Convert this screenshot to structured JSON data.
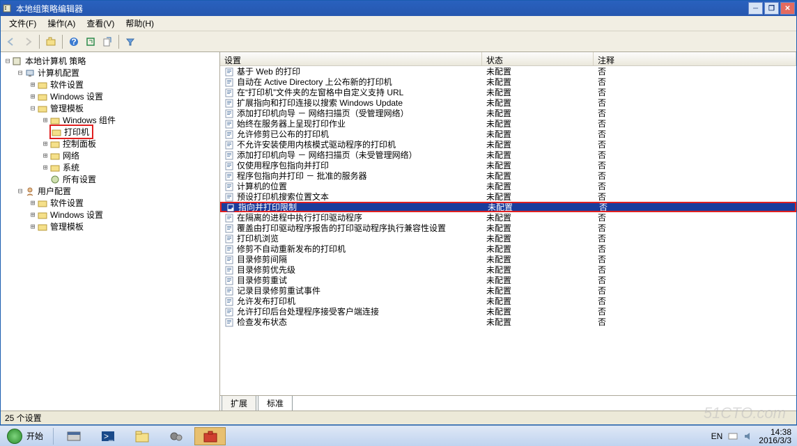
{
  "window": {
    "title": "本地组策略编辑器"
  },
  "menu": {
    "file": "文件(F)",
    "action": "操作(A)",
    "view": "查看(V)",
    "help": "帮助(H)"
  },
  "tree": {
    "root": "本地计算机 策略",
    "computer": "计算机配置",
    "computer_children": {
      "software": "软件设置",
      "windows": "Windows 设置",
      "admin": "管理模板",
      "admin_children": {
        "win_components": "Windows 组件",
        "printers": "打印机",
        "control_panel": "控制面板",
        "network": "网络",
        "system": "系统",
        "all_settings": "所有设置"
      }
    },
    "user": "用户配置",
    "user_children": {
      "software": "软件设置",
      "windows": "Windows 设置",
      "admin": "管理模板"
    }
  },
  "columns": {
    "setting": "设置",
    "state": "状态",
    "comment": "注释"
  },
  "rows": [
    {
      "name": "基于 Web 的打印",
      "state": "未配置",
      "comment": "否"
    },
    {
      "name": "自动在 Active Directory 上公布新的打印机",
      "state": "未配置",
      "comment": "否"
    },
    {
      "name": "在“打印机”文件夹的左窗格中自定义支持 URL",
      "state": "未配置",
      "comment": "否"
    },
    {
      "name": "扩展指向和打印连接以搜索 Windows Update",
      "state": "未配置",
      "comment": "否"
    },
    {
      "name": "添加打印机向导 － 网络扫描页（受管理网络）",
      "state": "未配置",
      "comment": "否"
    },
    {
      "name": "始终在服务器上呈现打印作业",
      "state": "未配置",
      "comment": "否"
    },
    {
      "name": "允许修剪已公布的打印机",
      "state": "未配置",
      "comment": "否"
    },
    {
      "name": "不允许安装使用内核模式驱动程序的打印机",
      "state": "未配置",
      "comment": "否"
    },
    {
      "name": "添加打印机向导 － 网络扫描页（未受管理网络）",
      "state": "未配置",
      "comment": "否"
    },
    {
      "name": "仅使用程序包指向并打印",
      "state": "未配置",
      "comment": "否"
    },
    {
      "name": "程序包指向并打印 － 批准的服务器",
      "state": "未配置",
      "comment": "否"
    },
    {
      "name": "计算机的位置",
      "state": "未配置",
      "comment": "否"
    },
    {
      "name": "预设打印机搜索位置文本",
      "state": "未配置",
      "comment": "否"
    },
    {
      "name": "指向并打印限制",
      "state": "未配置",
      "comment": "否",
      "selected": true,
      "highlighted": true
    },
    {
      "name": "在隔离的进程中执行打印驱动程序",
      "state": "未配置",
      "comment": "否"
    },
    {
      "name": "覆盖由打印驱动程序报告的打印驱动程序执行兼容性设置",
      "state": "未配置",
      "comment": "否"
    },
    {
      "name": "打印机浏览",
      "state": "未配置",
      "comment": "否"
    },
    {
      "name": "修剪不自动重新发布的打印机",
      "state": "未配置",
      "comment": "否"
    },
    {
      "name": "目录修剪间隔",
      "state": "未配置",
      "comment": "否"
    },
    {
      "name": "目录修剪优先级",
      "state": "未配置",
      "comment": "否"
    },
    {
      "name": "目录修剪重试",
      "state": "未配置",
      "comment": "否"
    },
    {
      "name": "记录目录修剪重试事件",
      "state": "未配置",
      "comment": "否"
    },
    {
      "name": "允许发布打印机",
      "state": "未配置",
      "comment": "否"
    },
    {
      "name": "允许打印后台处理程序接受客户端连接",
      "state": "未配置",
      "comment": "否"
    },
    {
      "name": "检查发布状态",
      "state": "未配置",
      "comment": "否"
    }
  ],
  "tabs": {
    "extended": "扩展",
    "standard": "标准"
  },
  "status": "25 个设置",
  "taskbar": {
    "start": "开始",
    "lang": "EN",
    "time": "14:38",
    "date": "2016/3/3"
  },
  "watermark": "51CTO.com"
}
